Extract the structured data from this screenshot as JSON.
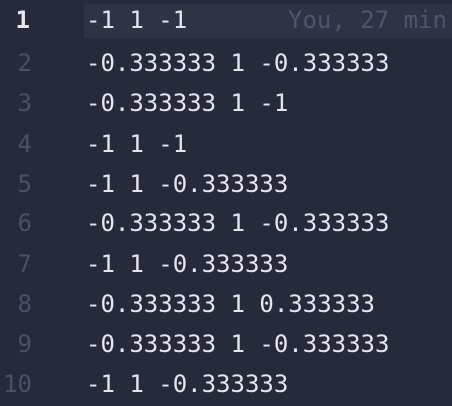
{
  "editor": {
    "current_line": 1,
    "blame": "You, 27 min",
    "lines": [
      {
        "number": "1",
        "text": "-1 1 -1"
      },
      {
        "number": "2",
        "text": "-0.333333 1 -0.333333"
      },
      {
        "number": "3",
        "text": "-0.333333 1 -1"
      },
      {
        "number": "4",
        "text": "-1 1 -1"
      },
      {
        "number": "5",
        "text": "-1 1 -0.333333"
      },
      {
        "number": "6",
        "text": "-0.333333 1 -0.333333"
      },
      {
        "number": "7",
        "text": "-1 1 -0.333333"
      },
      {
        "number": "8",
        "text": "-0.333333 1 0.333333"
      },
      {
        "number": "9",
        "text": "-0.333333 1 -0.333333"
      },
      {
        "number": "10",
        "text": "-1 1 -0.333333"
      }
    ]
  },
  "colors": {
    "background": "#262a3a",
    "current_line_highlight": "#2e3346",
    "text": "#e4e6ee",
    "gutter": "#4a5068",
    "gutter_active": "#e6e8ef",
    "blame": "#4f556b"
  }
}
